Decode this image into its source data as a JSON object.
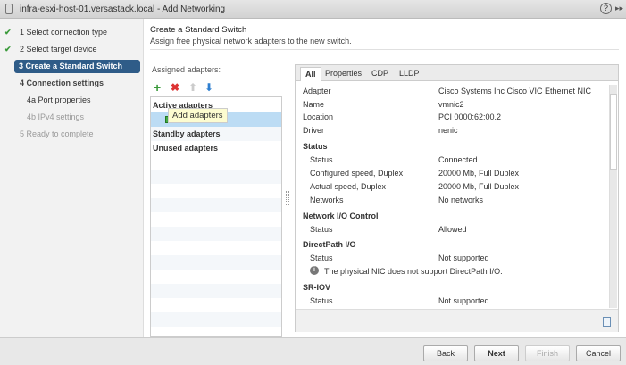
{
  "window": {
    "title": "infra-esxi-host-01.versastack.local - Add Networking"
  },
  "steps": [
    {
      "label": "1  Select connection type",
      "done": true
    },
    {
      "label": "2  Select target device",
      "done": true
    },
    {
      "label": "3  Create a Standard Switch",
      "active": true
    },
    {
      "label": "4  Connection settings"
    },
    {
      "label": "4a  Port properties"
    },
    {
      "label": "4b  IPv4 settings"
    },
    {
      "label": "5  Ready to complete"
    }
  ],
  "page": {
    "title": "Create a Standard Switch",
    "subtitle": "Assign free physical network adapters to the new switch."
  },
  "adapters": {
    "label": "Assigned adapters:",
    "groups": [
      "Active adapters",
      "Standby adapters",
      "Unused adapters"
    ],
    "tooltip": "Add adapters"
  },
  "tabs": [
    "All",
    "Properties",
    "CDP",
    "LLDP"
  ],
  "details": {
    "adapter": [
      "Adapter",
      "Cisco Systems Inc Cisco VIC Ethernet NIC"
    ],
    "name": [
      "Name",
      "vmnic2"
    ],
    "location": [
      "Location",
      "PCI 0000:62:00.2"
    ],
    "driver": [
      "Driver",
      "nenic"
    ],
    "status_hdr": "Status",
    "status": [
      "Status",
      "Connected"
    ],
    "cfg_speed": [
      "Configured speed, Duplex",
      "20000 Mb, Full Duplex"
    ],
    "act_speed": [
      "Actual speed, Duplex",
      "20000 Mb, Full Duplex"
    ],
    "networks": [
      "Networks",
      "No networks"
    ],
    "nioc_hdr": "Network I/O Control",
    "nioc_status": [
      "Status",
      "Allowed"
    ],
    "dp_hdr": "DirectPath I/O",
    "dp_status": [
      "Status",
      "Not supported"
    ],
    "dp_info": "The physical NIC does not support DirectPath I/O.",
    "sriov_hdr": "SR-IOV",
    "sriov_status": [
      "Status",
      "Not supported"
    ]
  },
  "buttons": {
    "back": "Back",
    "next": "Next",
    "finish": "Finish",
    "cancel": "Cancel"
  }
}
